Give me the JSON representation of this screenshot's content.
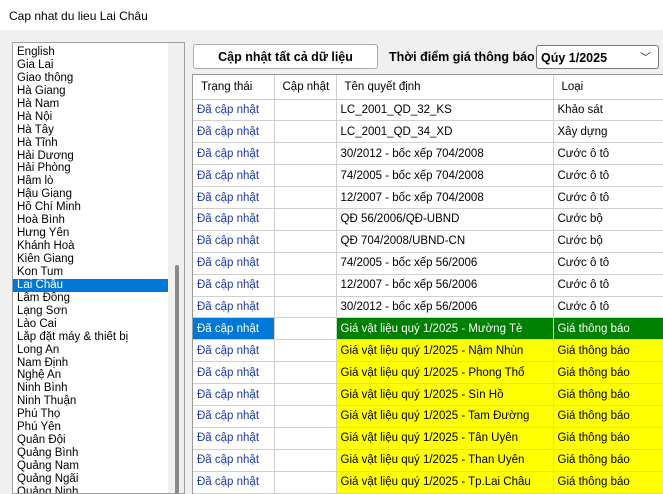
{
  "window": {
    "title": "Cap nhat du lieu Lai Châu"
  },
  "provinces": [
    "English",
    "Gia Lai",
    "Giao thông",
    "Hà Giang",
    "Hà Nam",
    "Hà Nội",
    "Hà Tây",
    "Hà Tĩnh",
    "Hải Dương",
    "Hải Phòng",
    "Hầm lò",
    "Hậu Giang",
    "Hồ Chí Minh",
    "Hoà Bình",
    "Hưng Yên",
    "Khánh Hoà",
    "Kiên Giang",
    "Kon Tum",
    "Lai Châu",
    "Lâm Đồng",
    "Lạng Sơn",
    "Lào Cai",
    "Lắp đặt máy & thiết bị",
    "Long An",
    "Nam Định",
    "Nghệ An",
    "Ninh Bình",
    "Ninh Thuận",
    "Phú Thọ",
    "Phú Yên",
    "Quân Đội",
    "Quảng Bình",
    "Quảng Nam",
    "Quảng Ngãi",
    "Quảng Ninh"
  ],
  "selected_province": "Lai Châu",
  "toolbar": {
    "update_all_label": "Cập nhật tất cả dữ liệu",
    "period_label": "Thời điểm giá thông báo",
    "period_value": "Qúy 1/2025"
  },
  "grid": {
    "columns": [
      "Trạng thái",
      "Cập nhật",
      "Tên quyết định",
      "Loại"
    ],
    "rows": [
      {
        "status": "Đã cập nhật",
        "update": "",
        "name": "LC_2001_QD_32_KS",
        "type": "Khảo sát",
        "hl": false
      },
      {
        "status": "Đã cập nhật",
        "update": "",
        "name": "LC_2001_QD_34_XD",
        "type": "Xây dựng",
        "hl": false
      },
      {
        "status": "Đã cập nhật",
        "update": "",
        "name": "30/2012 - bốc xếp 704/2008",
        "type": "Cước ô tô",
        "hl": false
      },
      {
        "status": "Đã cập nhật",
        "update": "",
        "name": "74/2005 - bốc xếp 704/2008",
        "type": "Cước ô tô",
        "hl": false
      },
      {
        "status": "Đã cập nhật",
        "update": "",
        "name": "12/2007 - bốc xếp 704/2008",
        "type": "Cước ô tô",
        "hl": false
      },
      {
        "status": "Đã cập nhật",
        "update": "",
        "name": "QĐ 56/2006/QĐ-UBND",
        "type": "Cước bộ",
        "hl": false
      },
      {
        "status": "Đã cập nhật",
        "update": "",
        "name": "QĐ 704/2008/UBND-CN",
        "type": "Cước bộ",
        "hl": false
      },
      {
        "status": "Đã cập nhật",
        "update": "",
        "name": "74/2005 - bốc xếp 56/2006",
        "type": "Cước ô tô",
        "hl": false
      },
      {
        "status": "Đã cập nhật",
        "update": "",
        "name": "12/2007 - bốc xếp 56/2006",
        "type": "Cước ô tô",
        "hl": false
      },
      {
        "status": "Đã cập nhật",
        "update": "",
        "name": "30/2012 - bốc xếp 56/2006",
        "type": "Cước ô tô",
        "hl": false
      },
      {
        "status": "Đã cập nhật",
        "update": "",
        "name": "Giá vật liệu quý 1/2025 - Mường Tè",
        "type": "Giá thông báo",
        "hl": true,
        "selected": true
      },
      {
        "status": "Đã cập nhật",
        "update": "",
        "name": "Giá vật liệu quý 1/2025 - Nậm Nhùn",
        "type": "Giá thông báo",
        "hl": true
      },
      {
        "status": "Đã cập nhật",
        "update": "",
        "name": "Giá vật liệu quý 1/2025 - Phong Thổ",
        "type": "Giá thông báo",
        "hl": true
      },
      {
        "status": "Đã cập nhật",
        "update": "",
        "name": "Giá vật liệu quý 1/2025 - Sìn Hồ",
        "type": "Giá thông báo",
        "hl": true
      },
      {
        "status": "Đã cập nhật",
        "update": "",
        "name": "Giá vật liệu quý 1/2025 - Tam Đường",
        "type": "Giá thông báo",
        "hl": true
      },
      {
        "status": "Đã cập nhật",
        "update": "",
        "name": "Giá vật liệu quý 1/2025 - Tân Uyên",
        "type": "Giá thông báo",
        "hl": true
      },
      {
        "status": "Đã cập nhật",
        "update": "",
        "name": "Giá vật liệu quý 1/2025 - Than Uyên",
        "type": "Giá thông báo",
        "hl": true
      },
      {
        "status": "Đã cập nhật",
        "update": "",
        "name": "Giá vật liệu quý 1/2025 - Tp.Lai Châu",
        "type": "Giá thông báo",
        "hl": true
      }
    ]
  },
  "colors": {
    "selection": "#0078d7",
    "highlight": "#ffff00",
    "highlight_selected": "#008000",
    "status_text": "#1a35b8"
  },
  "icons": {
    "period_dropdown": "chevron-down-icon"
  }
}
